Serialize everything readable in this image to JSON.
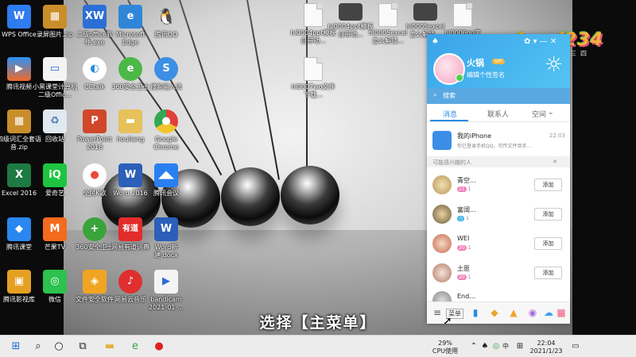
{
  "desktop_icons": {
    "wps": "WPS Office",
    "lupian": "录屏图片.zip",
    "erji": "二级office软件.exe",
    "edge": "Microsoft Edge",
    "qq": "腾讯QQ",
    "tengxun_video": "腾讯视频",
    "xiaohei": "小黑课堂计算机二级Offic...",
    "cctalk": "CCtalk",
    "safe": "360安全卫士",
    "sougou": "搜狗输入法",
    "sici": "四级词汇全套语音.zip",
    "recycle": "回收站",
    "ppt2016": "PowerPoint 2016",
    "houliang": "houliang",
    "chrome": "Google Chrome",
    "excel": "Excel 2016",
    "iqiyi": "爱奇艺",
    "quanmin": "全民K歌",
    "word2016": "Word 2016",
    "tx_meeting": "腾讯会议",
    "tx_class": "腾讯课堂",
    "mango": "芒果TV",
    "safe2": "360安全卫士",
    "youdao": "网易有道词典",
    "worddoc": "Word新建.docx",
    "tx_player": "腾讯影视库",
    "wechat": "微信",
    "wenjian": "文件安全软件",
    "netease_music": "网易云音乐",
    "bandicam": "bandicam 2021-01-...",
    "file1": "hl0004ppt模板自带动...",
    "file2": "hl0004ppt模板自带动...",
    "file3": "hl0005excel 怎么解锁...",
    "file4": "hl0005excel 怎么解锁...",
    "file5": "hl0006qq字体...",
    "file6": "hl0007wo文件下载..."
  },
  "caption": "选择【主菜单】",
  "watermark": {
    "logo": "Aowi234",
    "sub": "好生活好二三四"
  },
  "qq_panel": {
    "header_left_icon": "qq-tray-icon",
    "header_right": "✿ ▾ — ✕",
    "name": "火锅",
    "vip": "VIP",
    "signature": "编辑个性签名",
    "search_placeholder": "搜索",
    "tabs": [
      "消息",
      "联系人",
      "空间"
    ],
    "my_iphone": {
      "name": "我的iPhone",
      "time": "22:03",
      "sub": "你已登录手机QQ，可传文件到手..."
    },
    "may_know": "可能感兴趣的人",
    "suggestions": [
      {
        "name": "青空...",
        "level": "21",
        "extra": "1",
        "button": "添加"
      },
      {
        "name": "富阔...",
        "level": "",
        "extra": "1",
        "button": "添加"
      },
      {
        "name": "WEI",
        "level": "20",
        "extra": "1",
        "button": "添加"
      },
      {
        "name": "土匪",
        "level": "20",
        "extra": "1",
        "button": "添加"
      },
      {
        "name": "End...",
        "level": "",
        "extra": "",
        "button": ""
      }
    ],
    "footer_menu_label": "菜单"
  },
  "taskbar": {
    "cpu_percent": "29%",
    "cpu_label": "CPU使用",
    "ime": "中",
    "time": "22:04",
    "date": "2021/1/23"
  }
}
